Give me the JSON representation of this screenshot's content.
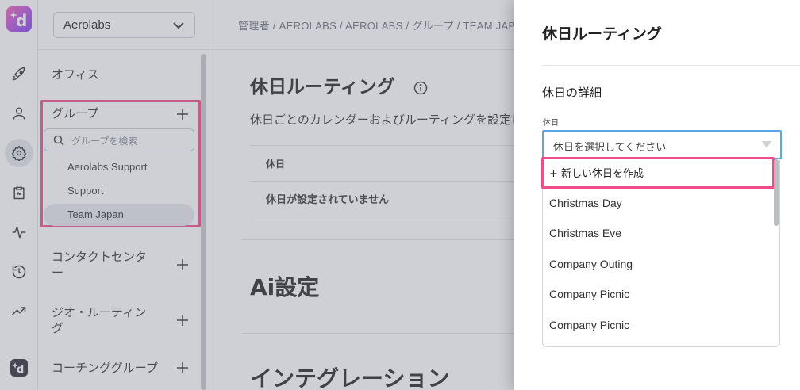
{
  "rail": {
    "icons": [
      "launch-icon",
      "user-icon",
      "settings-icon",
      "clipboard-icon",
      "activity-icon",
      "history-icon",
      "trending-icon"
    ],
    "active": "settings-icon",
    "logo": "d",
    "bottom_logo": "d"
  },
  "sidebar": {
    "org_select": "Aerolabs",
    "office_label": "オフィス",
    "group_label": "グループ",
    "group_search_placeholder": "グループを検索",
    "groups": [
      "Aerolabs Support",
      "Support",
      "Team Japan"
    ],
    "active_group": "Team Japan",
    "contact_center_label": "コンタクトセンター",
    "geo_routing_label": "ジオ・ルーティング",
    "coaching_group_label": "コーチンググループ"
  },
  "main": {
    "breadcrumb": "管理者 / AEROLABS / AEROLABS / グループ / TEAM JAPAN",
    "title": "休日ルーティング",
    "description": "休日ごとのカレンダーおよびルーティングを設定します",
    "table_header": "休日",
    "empty_message": "休日が設定されていません",
    "ai_section": "Ai設定",
    "integration_section": "インテグレーション"
  },
  "panel": {
    "title": "休日ルーティング",
    "section_title": "休日の詳細",
    "field_label": "休日",
    "select_placeholder": "休日を選択してください",
    "create_option": "+ 新しい休日を作成",
    "options": [
      "Christmas Day",
      "Christmas Eve",
      "Company Outing",
      "Company Picnic",
      "Company Picnic"
    ]
  },
  "colors": {
    "highlight": "#ee4c8a",
    "focus_border": "#5aa6e6",
    "logo_gradient_start": "#f35bb0",
    "logo_gradient_end": "#7b3ff0"
  }
}
